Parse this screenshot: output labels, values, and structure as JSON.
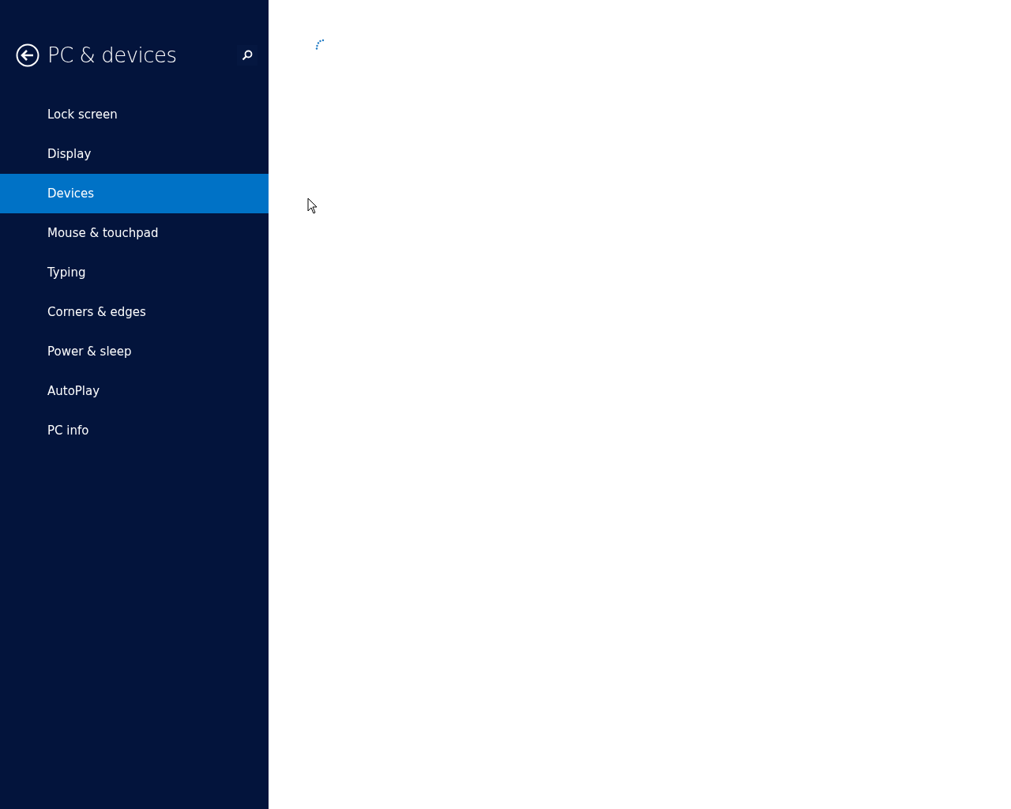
{
  "sidebar": {
    "title": "PC & devices",
    "items": [
      {
        "label": "Lock screen",
        "selected": false
      },
      {
        "label": "Display",
        "selected": false
      },
      {
        "label": "Devices",
        "selected": true
      },
      {
        "label": "Mouse & touchpad",
        "selected": false
      },
      {
        "label": "Typing",
        "selected": false
      },
      {
        "label": "Corners & edges",
        "selected": false
      },
      {
        "label": "Power & sleep",
        "selected": false
      },
      {
        "label": "AutoPlay",
        "selected": false
      },
      {
        "label": "PC info",
        "selected": false
      }
    ]
  },
  "content": {
    "loading": true
  }
}
